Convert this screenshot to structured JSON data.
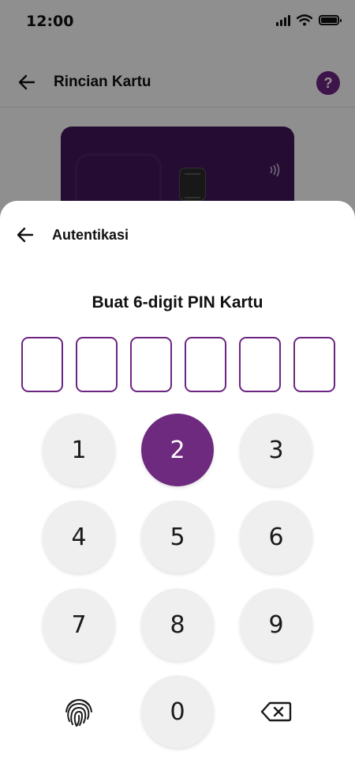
{
  "status_bar": {
    "time": "12:00"
  },
  "background_screen": {
    "title": "Rincian Kartu",
    "help_label": "?"
  },
  "sheet": {
    "title": "Autentikasi",
    "heading": "Buat 6-digit PIN Kartu",
    "pin_length": 6
  },
  "keypad": {
    "keys": [
      "1",
      "2",
      "3",
      "4",
      "5",
      "6",
      "7",
      "8",
      "9",
      "0"
    ],
    "active_key": "2",
    "left_action": "fingerprint-icon",
    "right_action": "backspace-icon"
  },
  "colors": {
    "accent": "#6e2a7e",
    "pin_border": "#6b2580",
    "key_bg": "#efefef",
    "card": "#3f1659"
  }
}
